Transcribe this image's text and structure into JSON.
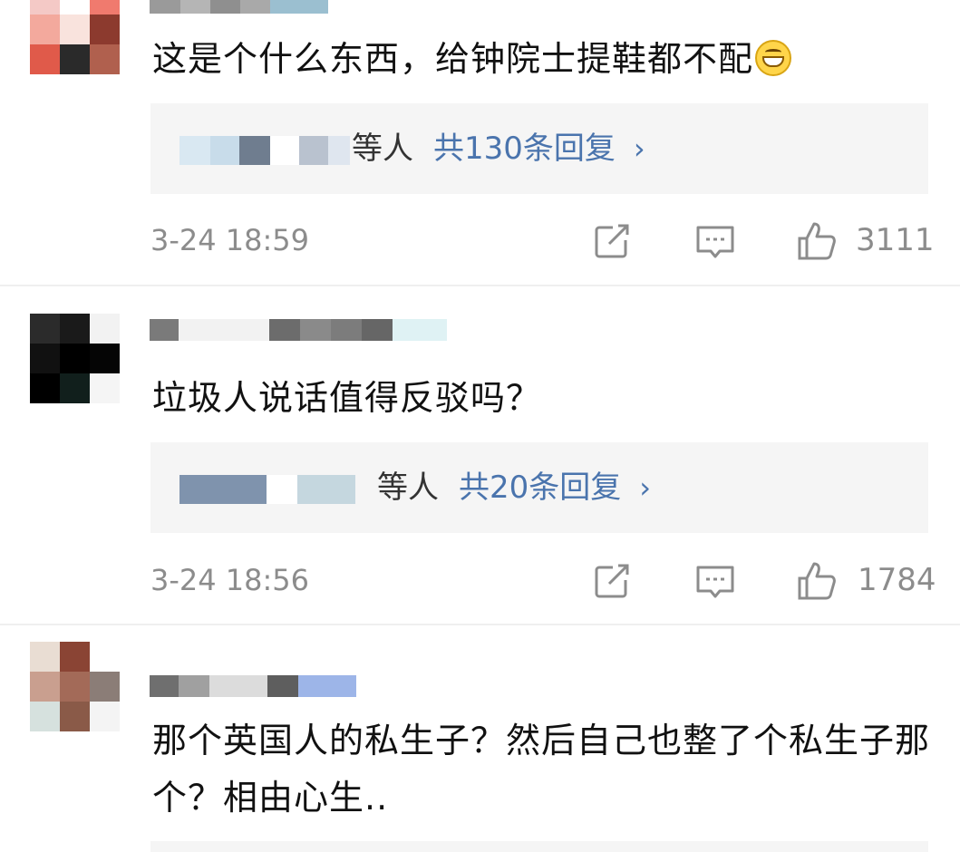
{
  "comments": [
    {
      "text": "这是个什么东西，给钟院士提鞋都不配",
      "emoji_icon": "grinning-face-icon",
      "reply": {
        "who": "等人",
        "count": "共130条回复",
        "chevron": "›"
      },
      "time": "3-24 18:59",
      "likes": "3111",
      "avatar_colors": [
        "#f4c9c6",
        "#ffffff",
        "#f07a6e",
        "#f3a99d",
        "#f9e3dd",
        "#8c3a2e",
        "#e05a4a",
        "#2a2a2a",
        "#b0604e"
      ],
      "name_blur_colors": [
        "#9a9a9a",
        "#b5b5b5",
        "#8f8f8f",
        "#a9a9a9",
        "#9bbfd0"
      ]
    },
    {
      "text": "垃圾人说话值得反驳吗？",
      "reply": {
        "who": "等人",
        "count": "共20条回复",
        "chevron": "›"
      },
      "time": "3-24 18:56",
      "likes": "1784",
      "avatar_colors": [
        "#2b2b2b",
        "#1a1a1a",
        "#f2f2f2",
        "#111111",
        "#000000",
        "#050505",
        "#000000",
        "#111f1c",
        "#f5f5f5"
      ],
      "name_blur_colors": [
        "#7a7a7a",
        "#f2f2f2",
        "#6c6c6c",
        "#8a8a8a",
        "#7c7c7c",
        "#666666",
        "#dff2f4"
      ]
    },
    {
      "text": "那个英国人的私生子？然后自己也整了个私生子那个？相由心生..",
      "avatar_colors": [
        "#e9ddd3",
        "#8a4434",
        "#ffffff",
        "#c99f8f",
        "#a36a58",
        "#8b7d77",
        "#d6e1de",
        "#8a5a48",
        "#f4f4f4"
      ],
      "name_blur_colors": [
        "#6f6f6f",
        "#a0a0a0",
        "#dcdcdc",
        "#5e5e5e",
        "#9db5e8"
      ]
    }
  ],
  "icons": {
    "repost": "repost-icon",
    "comment": "comment-icon",
    "like": "thumbs-up-icon"
  },
  "colors": {
    "link_blue": "#4a74ad",
    "meta_gray": "#8c8c8c",
    "reply_bg": "#f5f5f5"
  }
}
